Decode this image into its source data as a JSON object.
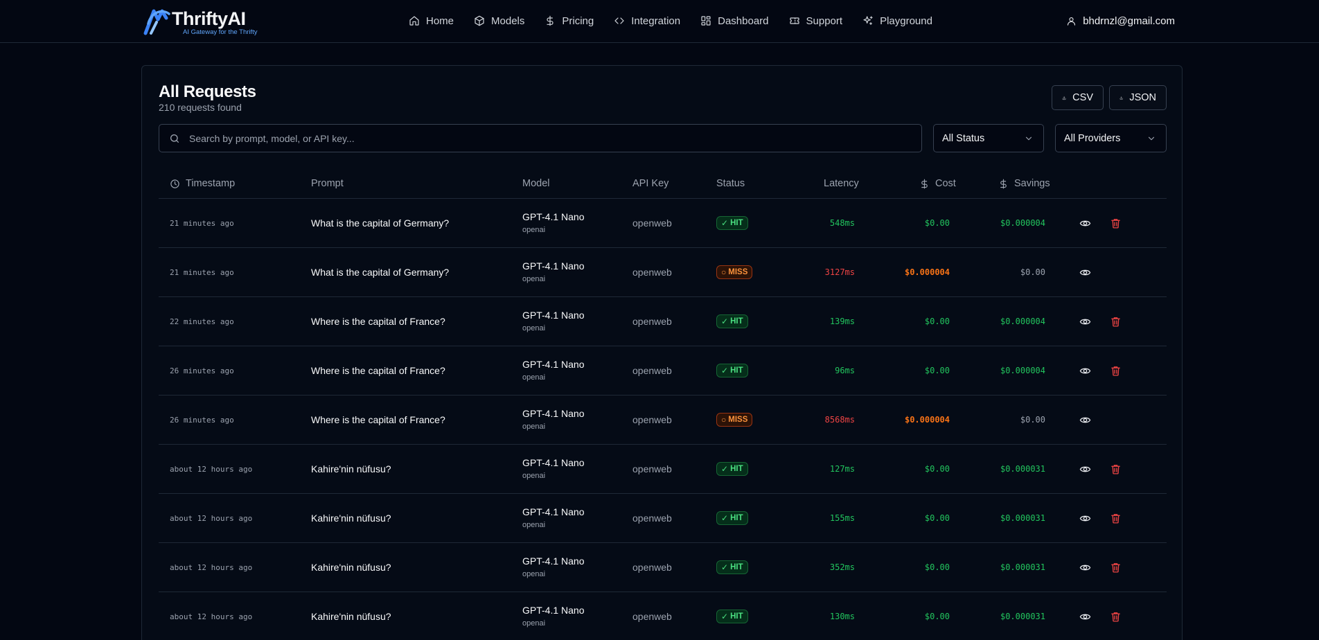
{
  "brand": {
    "name": "ThriftyAI",
    "tagline": "AI Gateway for the Thrifty"
  },
  "nav": {
    "links": [
      {
        "label": "Home",
        "icon": "home-icon"
      },
      {
        "label": "Models",
        "icon": "box-icon"
      },
      {
        "label": "Pricing",
        "icon": "dollar-icon"
      },
      {
        "label": "Integration",
        "icon": "code-icon"
      },
      {
        "label": "Dashboard",
        "icon": "grid-icon"
      },
      {
        "label": "Support",
        "icon": "ticket-icon"
      },
      {
        "label": "Playground",
        "icon": "sparkles-icon"
      }
    ],
    "user_email": "bhdrnzl@gmail.com"
  },
  "page": {
    "title": "All Requests",
    "subtitle": "210 requests found",
    "export_csv": "CSV",
    "export_json": "JSON",
    "search_placeholder": "Search by prompt, model, or API key...",
    "status_filter": "All Status",
    "provider_filter": "All Providers"
  },
  "table": {
    "headers": {
      "timestamp": "Timestamp",
      "prompt": "Prompt",
      "model": "Model",
      "api_key": "API Key",
      "status": "Status",
      "latency": "Latency",
      "cost": "Cost",
      "savings": "Savings"
    },
    "rows": [
      {
        "time": "21 minutes ago",
        "prompt": "What is the capital of Germany?",
        "model": "GPT-4.1 Nano",
        "provider": "openai",
        "api_key": "openweb",
        "status": "HIT",
        "latency": "548ms",
        "cost": "$0.00",
        "savings": "$0.000004"
      },
      {
        "time": "21 minutes ago",
        "prompt": "What is the capital of Germany?",
        "model": "GPT-4.1 Nano",
        "provider": "openai",
        "api_key": "openweb",
        "status": "MISS",
        "latency": "3127ms",
        "cost": "$0.000004",
        "savings": "$0.00"
      },
      {
        "time": "22 minutes ago",
        "prompt": "Where is the capital of France?",
        "model": "GPT-4.1 Nano",
        "provider": "openai",
        "api_key": "openweb",
        "status": "HIT",
        "latency": "139ms",
        "cost": "$0.00",
        "savings": "$0.000004"
      },
      {
        "time": "26 minutes ago",
        "prompt": "Where is the capital of France?",
        "model": "GPT-4.1 Nano",
        "provider": "openai",
        "api_key": "openweb",
        "status": "HIT",
        "latency": "96ms",
        "cost": "$0.00",
        "savings": "$0.000004"
      },
      {
        "time": "26 minutes ago",
        "prompt": "Where is the capital of France?",
        "model": "GPT-4.1 Nano",
        "provider": "openai",
        "api_key": "openweb",
        "status": "MISS",
        "latency": "8568ms",
        "cost": "$0.000004",
        "savings": "$0.00"
      },
      {
        "time": "about 12 hours ago",
        "prompt": "Kahire'nin nüfusu?",
        "model": "GPT-4.1 Nano",
        "provider": "openai",
        "api_key": "openweb",
        "status": "HIT",
        "latency": "127ms",
        "cost": "$0.00",
        "savings": "$0.000031"
      },
      {
        "time": "about 12 hours ago",
        "prompt": "Kahire'nin nüfusu?",
        "model": "GPT-4.1 Nano",
        "provider": "openai",
        "api_key": "openweb",
        "status": "HIT",
        "latency": "155ms",
        "cost": "$0.00",
        "savings": "$0.000031"
      },
      {
        "time": "about 12 hours ago",
        "prompt": "Kahire'nin nüfusu?",
        "model": "GPT-4.1 Nano",
        "provider": "openai",
        "api_key": "openweb",
        "status": "HIT",
        "latency": "352ms",
        "cost": "$0.00",
        "savings": "$0.000031"
      },
      {
        "time": "about 12 hours ago",
        "prompt": "Kahire'nin nüfusu?",
        "model": "GPT-4.1 Nano",
        "provider": "openai",
        "api_key": "openweb",
        "status": "HIT",
        "latency": "130ms",
        "cost": "$0.00",
        "savings": "$0.000031"
      }
    ]
  },
  "colors": {
    "background": "#030712",
    "hit": "#22c55e",
    "miss": "#f97316",
    "error": "#ef4444",
    "accent": "#60a5fa"
  }
}
